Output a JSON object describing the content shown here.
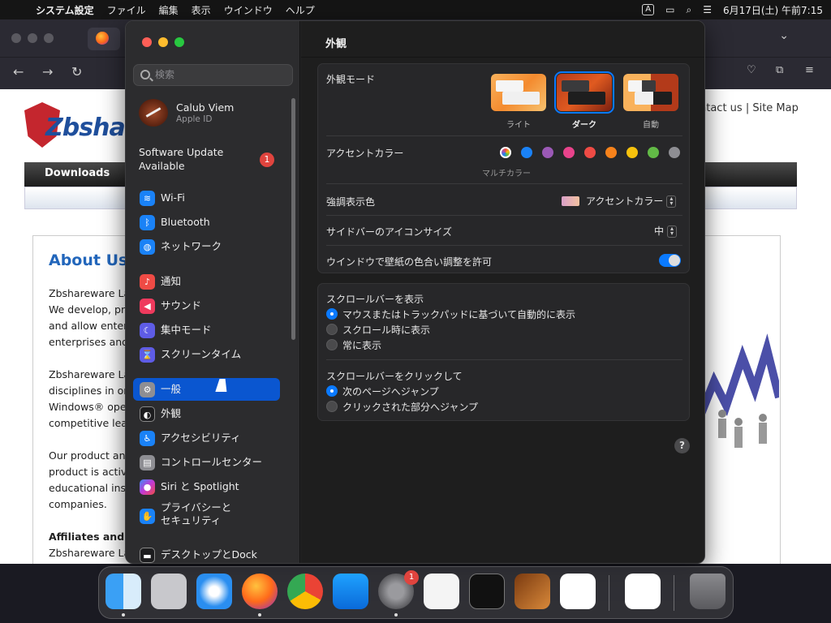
{
  "menubar": {
    "app_name": "システム設定",
    "items": [
      "ファイル",
      "編集",
      "表示",
      "ウインドウ",
      "ヘルプ"
    ],
    "input_indicator": "A",
    "datetime": "6月17日(土) 午前7:15"
  },
  "browser": {
    "logo_text": "Zbshare",
    "top_links": "ntact us | Site Map",
    "nav_label": "Downloads",
    "about_title": "About Us",
    "paragraphs": [
      [
        "Zbshareware La",
        "We develop, pr",
        "and allow enter",
        "enterprises and"
      ],
      [
        "Zbshareware La",
        "disciplines in or",
        "Windows® ope",
        "competitive lea"
      ],
      [
        "Our product an",
        "product is activ",
        "educational ins",
        "companies."
      ]
    ],
    "affiliates": "Affiliates and",
    "last_line": "Zbshareware La"
  },
  "sidebar": {
    "search_placeholder": "検索",
    "profile_name": "Calub Viem",
    "profile_sub": "Apple ID",
    "software_update": [
      "Software Update",
      "Available"
    ],
    "update_badge": "1",
    "items": [
      {
        "label": "Wi-Fi",
        "icon": "wifi-icon",
        "color": "#1a82f7"
      },
      {
        "label": "Bluetooth",
        "icon": "bluetooth-icon",
        "color": "#1a82f7"
      },
      {
        "label": "ネットワーク",
        "icon": "globe-icon",
        "color": "#1a82f7"
      },
      {
        "label": "通知",
        "icon": "bell-icon",
        "color": "#ef4b45"
      },
      {
        "label": "サウンド",
        "icon": "speaker-icon",
        "color": "#ef3a5d"
      },
      {
        "label": "集中モード",
        "icon": "moon-icon",
        "color": "#5e5ce6"
      },
      {
        "label": "スクリーンタイム",
        "icon": "hourglass-icon",
        "color": "#5e5ce6"
      },
      {
        "label": "一般",
        "icon": "gear-icon",
        "color": "#8e8e93"
      },
      {
        "label": "外観",
        "icon": "appearance-icon",
        "color": "#1c1c1e"
      },
      {
        "label": "アクセシビリティ",
        "icon": "accessibility-icon",
        "color": "#1a82f7"
      },
      {
        "label": "コントロールセンター",
        "icon": "control-center-icon",
        "color": "#8e8e93"
      },
      {
        "label": "Siri と Spotlight",
        "icon": "siri-icon",
        "color": "#7a3fd6"
      },
      {
        "label": "プライバシーと",
        "label2": "セキュリティ",
        "icon": "hand-icon",
        "color": "#1a82f7"
      },
      {
        "label": "デスクトップとDock",
        "icon": "dock-icon",
        "color": "#1c1c1e"
      }
    ]
  },
  "main": {
    "title": "外観",
    "appearance_mode_label": "外観モード",
    "modes": [
      "ライト",
      "ダーク",
      "自動"
    ],
    "selected_mode": "ダーク",
    "accent_label": "アクセントカラー",
    "accent_colors": [
      "#1a82f7",
      "#9b59b6",
      "#e8438b",
      "#ef4b45",
      "#f7821b",
      "#f7c20d",
      "#62ba46",
      "#8e8e93"
    ],
    "multicolor_label": "マルチカラー",
    "highlight_label": "強調表示色",
    "highlight_value": "アクセントカラー",
    "sidebar_icon_label": "サイドバーのアイコンサイズ",
    "sidebar_icon_value": "中",
    "wallpaper_tint_label": "ウインドウで壁紙の色合い調整を許可",
    "wallpaper_tint_on": true,
    "scrollbar_show_label": "スクロールバーを表示",
    "scrollbar_show_options": [
      "マウスまたはトラックパッドに基づいて自動的に表示",
      "スクロール時に表示",
      "常に表示"
    ],
    "scrollbar_click_label": "スクロールバーをクリックして",
    "scrollbar_click_options": [
      "次のページへジャンプ",
      "クリックされた部分へジャンプ"
    ],
    "help": "?"
  },
  "dock": {
    "apps": [
      "finder-icon",
      "launchpad-icon",
      "safari-icon",
      "firefox-icon",
      "chrome-icon",
      "app-store-icon",
      "system-settings-icon",
      "textedit-icon",
      "terminal-icon",
      "garageband-icon",
      "vscode-icon",
      "visual-studio-icon",
      "trash-icon"
    ],
    "settings_badge": "1"
  }
}
